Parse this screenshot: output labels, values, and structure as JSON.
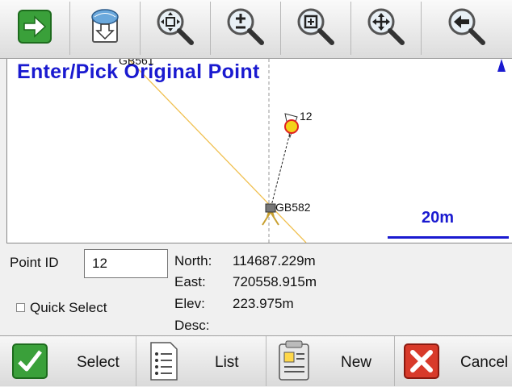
{
  "toolbar": {
    "buttons": [
      {
        "name": "forward-arrow"
      },
      {
        "name": "map-download"
      },
      {
        "name": "zoom-extents"
      },
      {
        "name": "zoom-in-out"
      },
      {
        "name": "zoom-window"
      },
      {
        "name": "pan"
      },
      {
        "name": "back"
      }
    ]
  },
  "map": {
    "title": "Enter/Pick Original Point",
    "points": [
      {
        "label": "GB561"
      },
      {
        "label": "12"
      },
      {
        "label": "GB582"
      }
    ],
    "scale_label": "20m",
    "colors": {
      "title": "#1a1ad0",
      "line": "#f0c050",
      "point_fill": "#f3d21a",
      "point_ring": "#e02020"
    }
  },
  "info": {
    "point_id_label": "Point ID",
    "point_id_value": "12",
    "quick_select_label": "Quick Select",
    "north_label": "North:",
    "north_value": "114687.229m",
    "east_label": "East:",
    "east_value": "720558.915m",
    "elev_label": "Elev:",
    "elev_value": "223.975m",
    "desc_label": "Desc:",
    "desc_value": ""
  },
  "bottom": {
    "select_label": "Select",
    "list_label": "List",
    "new_label": "New",
    "cancel_label": "Cancel"
  }
}
